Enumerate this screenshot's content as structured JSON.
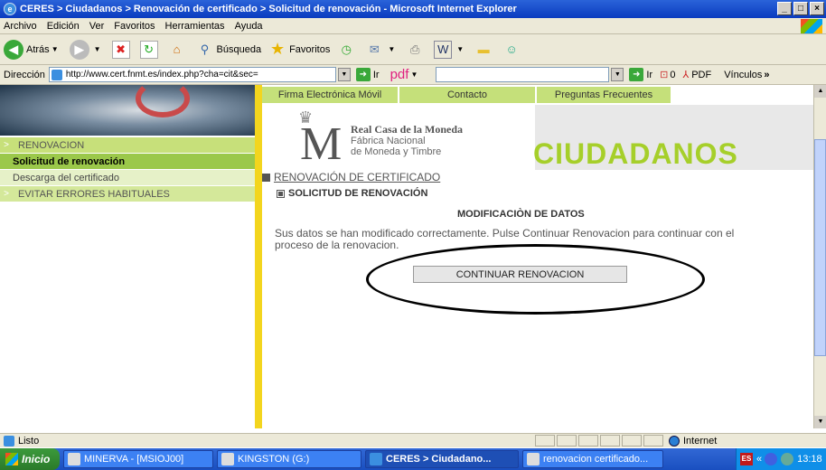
{
  "window": {
    "title": "CERES > Ciudadanos > Renovación de certificado > Solicitud de renovación - Microsoft Internet Explorer"
  },
  "menubar": [
    "Archivo",
    "Edición",
    "Ver",
    "Favoritos",
    "Herramientas",
    "Ayuda"
  ],
  "toolbar": {
    "back": "Atrás",
    "search": "Búsqueda",
    "favorites": "Favoritos"
  },
  "address": {
    "label": "Dirección",
    "url": "http://www.cert.fnmt.es/index.php?cha=cit&sec=",
    "go": "Ir",
    "pdf_search": "pdf",
    "go2": "Ir",
    "count": "0",
    "pdf": "PDF",
    "links": "Vínculos"
  },
  "topnav": [
    "Firma Electrónica Móvil",
    "Contacto",
    "Preguntas Frecuentes"
  ],
  "logo": {
    "line1": "Real Casa de la Moneda",
    "line2": "Fábrica Nacional",
    "line3": "de Moneda y Timbre"
  },
  "banner_title": "CIUDADANOS",
  "sidebar": {
    "items": [
      {
        "label": "RENOVACION",
        "arrow": ">"
      },
      {
        "label": "Solicitud de renovación"
      },
      {
        "label": "Descarga del certificado"
      },
      {
        "label": "EVITAR ERRORES HABITUALES",
        "arrow": ">"
      }
    ]
  },
  "content": {
    "section_link": "RENOVACIÓN DE CERTIFICADO",
    "subsection": "SOLICITUD DE RENOVACIÓN",
    "heading": "MODIFICACIÒN DE DATOS",
    "message": "Sus datos se han modificado correctamente. Pulse Continuar Renovacion para continuar con el proceso de la renovacion.",
    "button": "CONTINUAR RENOVACION"
  },
  "status": {
    "text": "Listo",
    "zone": "Internet"
  },
  "taskbar": {
    "start": "Inicio",
    "tasks": [
      "MINERVA - [MSIOJ00]",
      "KINGSTON (G:)",
      "CERES > Ciudadano...",
      "renovacion certificado..."
    ],
    "tray_chevron": "«",
    "clock": "13:18"
  }
}
